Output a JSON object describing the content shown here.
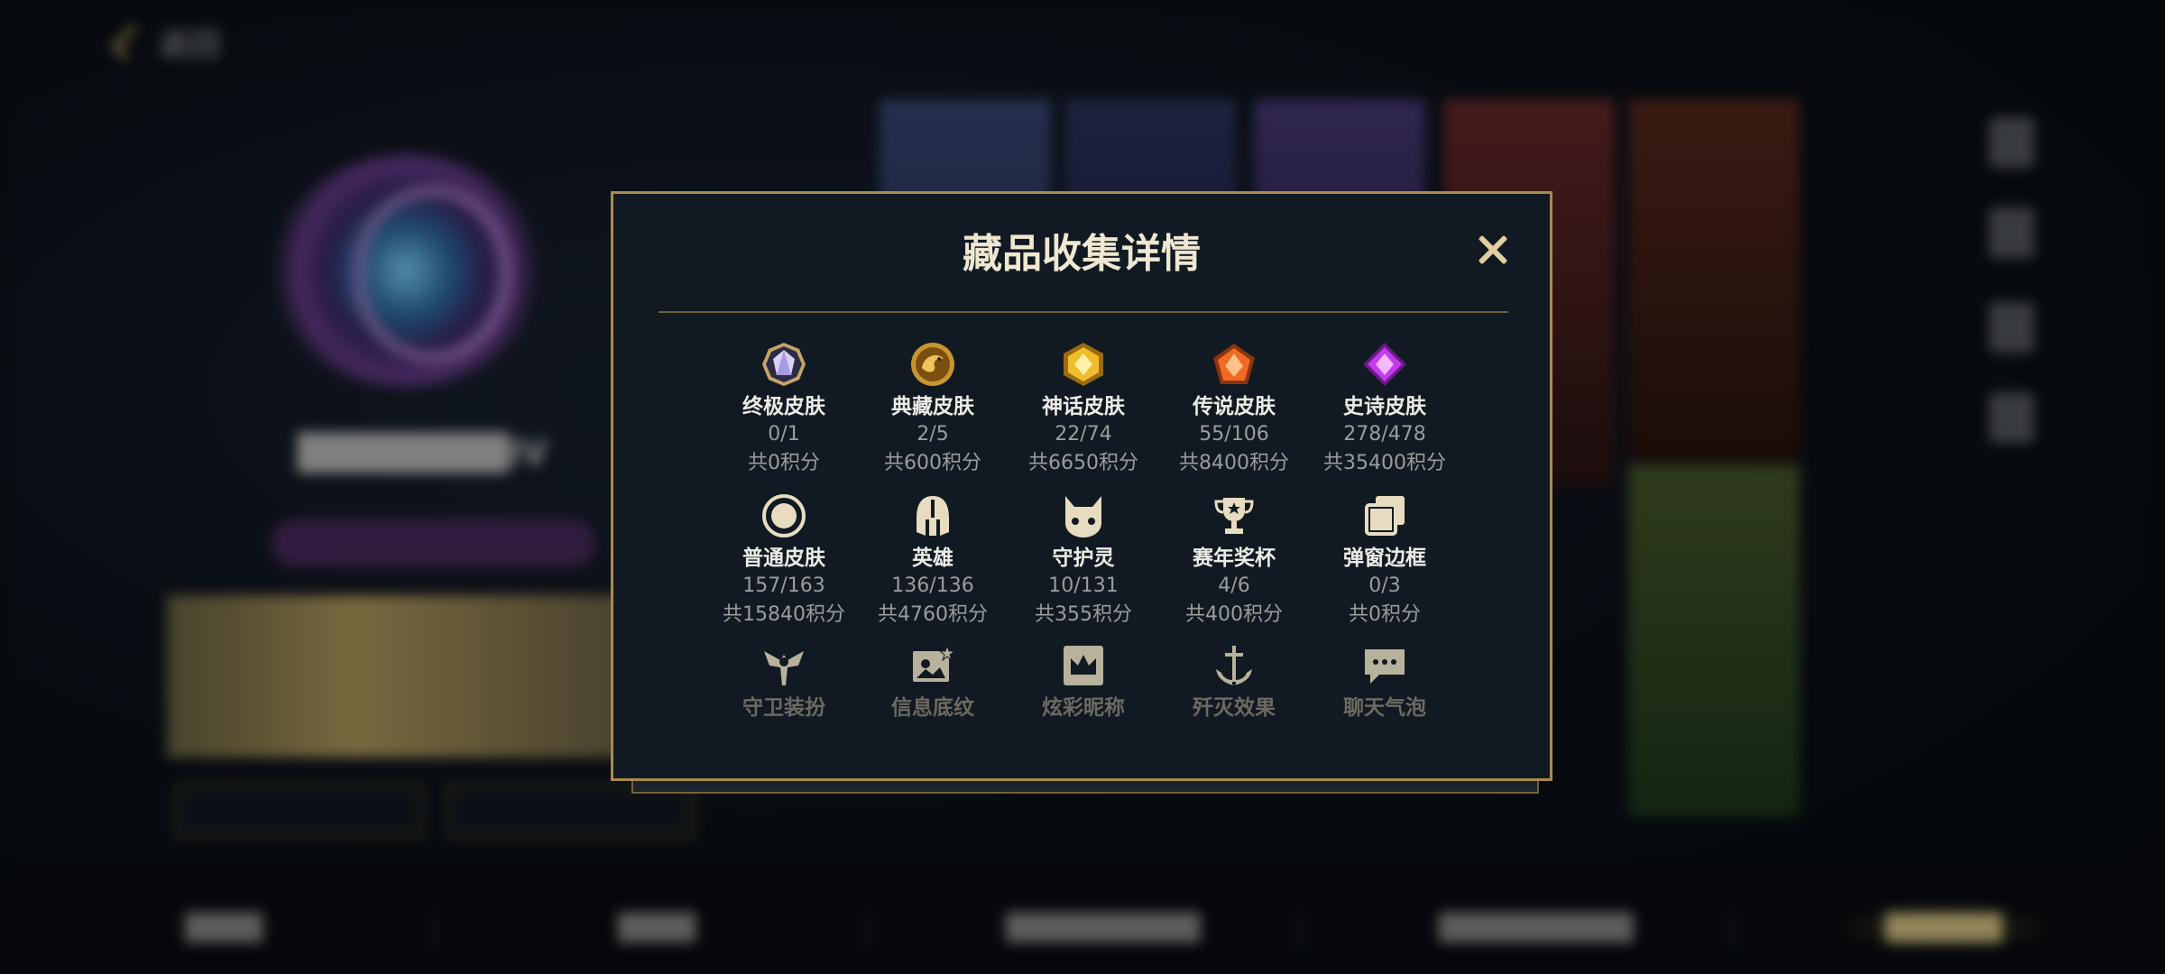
{
  "modal": {
    "title": "藏品收集详情",
    "rows": [
      [
        {
          "name": "终极皮肤",
          "count": "0/1",
          "points": "共0积分",
          "icon": "ultimate-skin-gem-icon"
        },
        {
          "name": "典藏皮肤",
          "count": "2/5",
          "points": "共600积分",
          "icon": "prestige-dragon-coin-icon"
        },
        {
          "name": "神话皮肤",
          "count": "22/74",
          "points": "共6650积分",
          "icon": "mythic-gold-gem-icon"
        },
        {
          "name": "传说皮肤",
          "count": "55/106",
          "points": "共8400积分",
          "icon": "legendary-orange-gem-icon"
        },
        {
          "name": "史诗皮肤",
          "count": "278/478",
          "points": "共35400积分",
          "icon": "epic-purple-gem-icon"
        }
      ],
      [
        {
          "name": "普通皮肤",
          "count": "157/163",
          "points": "共15840积分",
          "icon": "standard-skin-ring-icon"
        },
        {
          "name": "英雄",
          "count": "136/136",
          "points": "共4760积分",
          "icon": "champion-helmet-icon"
        },
        {
          "name": "守护灵",
          "count": "10/131",
          "points": "共355积分",
          "icon": "companion-creature-icon"
        },
        {
          "name": "赛年奖杯",
          "count": "4/6",
          "points": "共400积分",
          "icon": "trophy-icon"
        },
        {
          "name": "弹窗边框",
          "count": "0/3",
          "points": "共0积分",
          "icon": "frame-stack-icon"
        }
      ],
      [
        {
          "name": "守卫装扮",
          "icon": "ward-skin-icon"
        },
        {
          "name": "信息底纹",
          "icon": "profile-banner-icon"
        },
        {
          "name": "炫彩昵称",
          "icon": "nickname-crown-icon"
        },
        {
          "name": "歼灭效果",
          "icon": "ace-anchor-icon"
        },
        {
          "name": "聊天气泡",
          "icon": "chat-bubble-icon"
        }
      ]
    ]
  },
  "background": {
    "back_label": "返回",
    "player_name": "████████IV",
    "bottom_nav": [
      "████",
      "████",
      "██████████",
      "██████████",
      "██████"
    ]
  },
  "colors": {
    "gold": "#aa8a4c",
    "panel": "#111a22",
    "title": "#efe7d1"
  }
}
